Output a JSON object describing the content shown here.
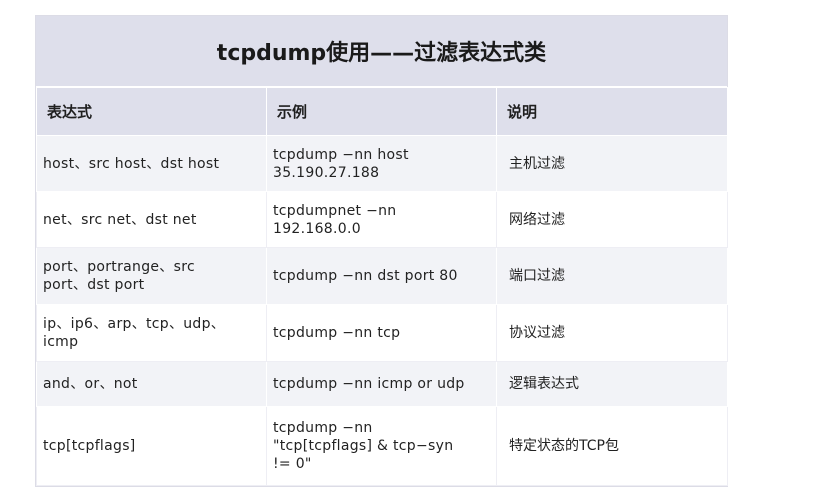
{
  "table": {
    "title": "tcpdump使用——过滤表达式类",
    "headers": [
      "表达式",
      "示例",
      "说明"
    ],
    "rows": [
      {
        "expr": "host、src host、dst host",
        "example": "tcpdump −nn host\n35.190.27.188",
        "desc": "主机过滤"
      },
      {
        "expr": "net、src net、dst net",
        "example": "tcpdumpnet −nn\n192.168.0.0",
        "desc": "网络过滤"
      },
      {
        "expr": "port、portrange、src\nport、dst port",
        "example": "tcpdump −nn dst port 80",
        "desc": "端口过滤"
      },
      {
        "expr": "ip、ip6、arp、tcp、udp、\nicmp",
        "example": "tcpdump −nn tcp",
        "desc": "协议过滤"
      },
      {
        "expr": "and、or、not",
        "example": "tcpdump −nn icmp or udp",
        "desc": "逻辑表达式"
      },
      {
        "expr": "tcp[tcpflags]",
        "example": "tcpdump −nn\n\"tcp[tcpflags] & tcp−syn\n!= 0\"",
        "desc": "特定状态的TCP包"
      }
    ]
  }
}
